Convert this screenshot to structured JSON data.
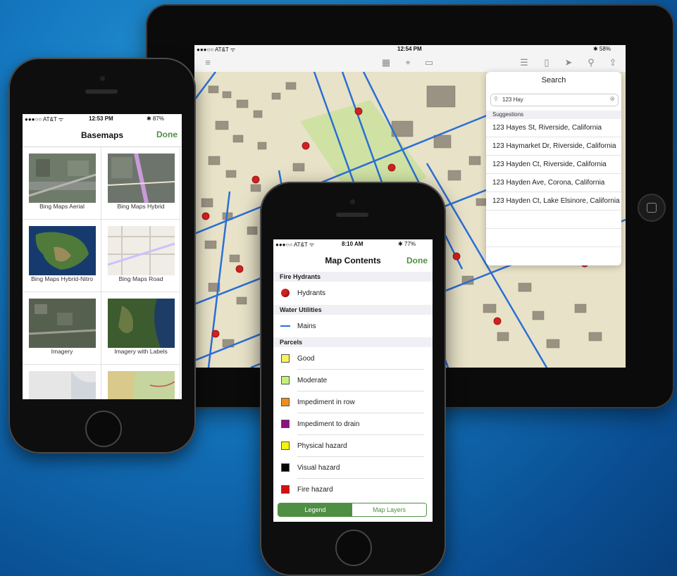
{
  "tablet": {
    "status": {
      "carrier": "●●●○○ AT&T ᯤ",
      "time": "12:54 PM",
      "battery": "✱ 58%"
    },
    "search": {
      "title": "Search",
      "query": "123 Hay",
      "suggestions_header": "Suggestions",
      "suggestions": [
        "123 Hayes St, Riverside, California",
        "123 Haymarket Dr, Riverside, California",
        "123 Hayden Ct, Riverside, California",
        "123 Hayden Ave, Corona, California",
        "123 Hayden Ct, Lake Elsinore, California"
      ]
    },
    "toolbar_icons": [
      "menu-icon",
      "qr-icon",
      "gps-icon",
      "ruler-icon",
      "list-icon",
      "book-icon",
      "navigate-icon",
      "search-icon",
      "share-icon"
    ]
  },
  "basemaps_phone": {
    "status": {
      "carrier": "●●●○○ AT&T ᯤ",
      "time": "12:53 PM",
      "battery": "✱ 87%"
    },
    "title": "Basemaps",
    "done": "Done",
    "items": [
      {
        "label": "Bing Maps Aerial"
      },
      {
        "label": "Bing Maps Hybrid"
      },
      {
        "label": "Bing Maps Hybrid-Nitro"
      },
      {
        "label": "Bing Maps Road"
      },
      {
        "label": "Imagery"
      },
      {
        "label": "Imagery with Labels"
      }
    ]
  },
  "contents_phone": {
    "status": {
      "carrier": "●●●○○ AT&T ᯤ",
      "time": "8:10 AM",
      "battery": "✱ 77%"
    },
    "title": "Map Contents",
    "done": "Done",
    "sections": [
      {
        "header": "Fire Hydrants",
        "rows": [
          {
            "label": "Hydrants",
            "symbol": "dot",
            "color": "#d32020"
          }
        ]
      },
      {
        "header": "Water Utilities",
        "rows": [
          {
            "label": "Mains",
            "symbol": "line",
            "color": "#2a6fd6"
          }
        ]
      },
      {
        "header": "Parcels",
        "rows": [
          {
            "label": "Good",
            "symbol": "square",
            "color": "#f7f25a"
          },
          {
            "label": "Moderate",
            "symbol": "square",
            "color": "#c6f07a"
          },
          {
            "label": "Impediment in row",
            "symbol": "square",
            "color": "#f08c1e"
          },
          {
            "label": "Impediment to drain",
            "symbol": "square",
            "color": "#8e0f7e"
          },
          {
            "label": "Physical hazard",
            "symbol": "square",
            "color": "#f7f20a"
          },
          {
            "label": "Visual hazard",
            "symbol": "square",
            "color": "#050505"
          },
          {
            "label": "Fire hazard",
            "symbol": "square",
            "color": "#d80e0e"
          }
        ]
      }
    ],
    "segments": {
      "legend": "Legend",
      "layers": "Map Layers"
    },
    "accent": "#4f8f44"
  }
}
